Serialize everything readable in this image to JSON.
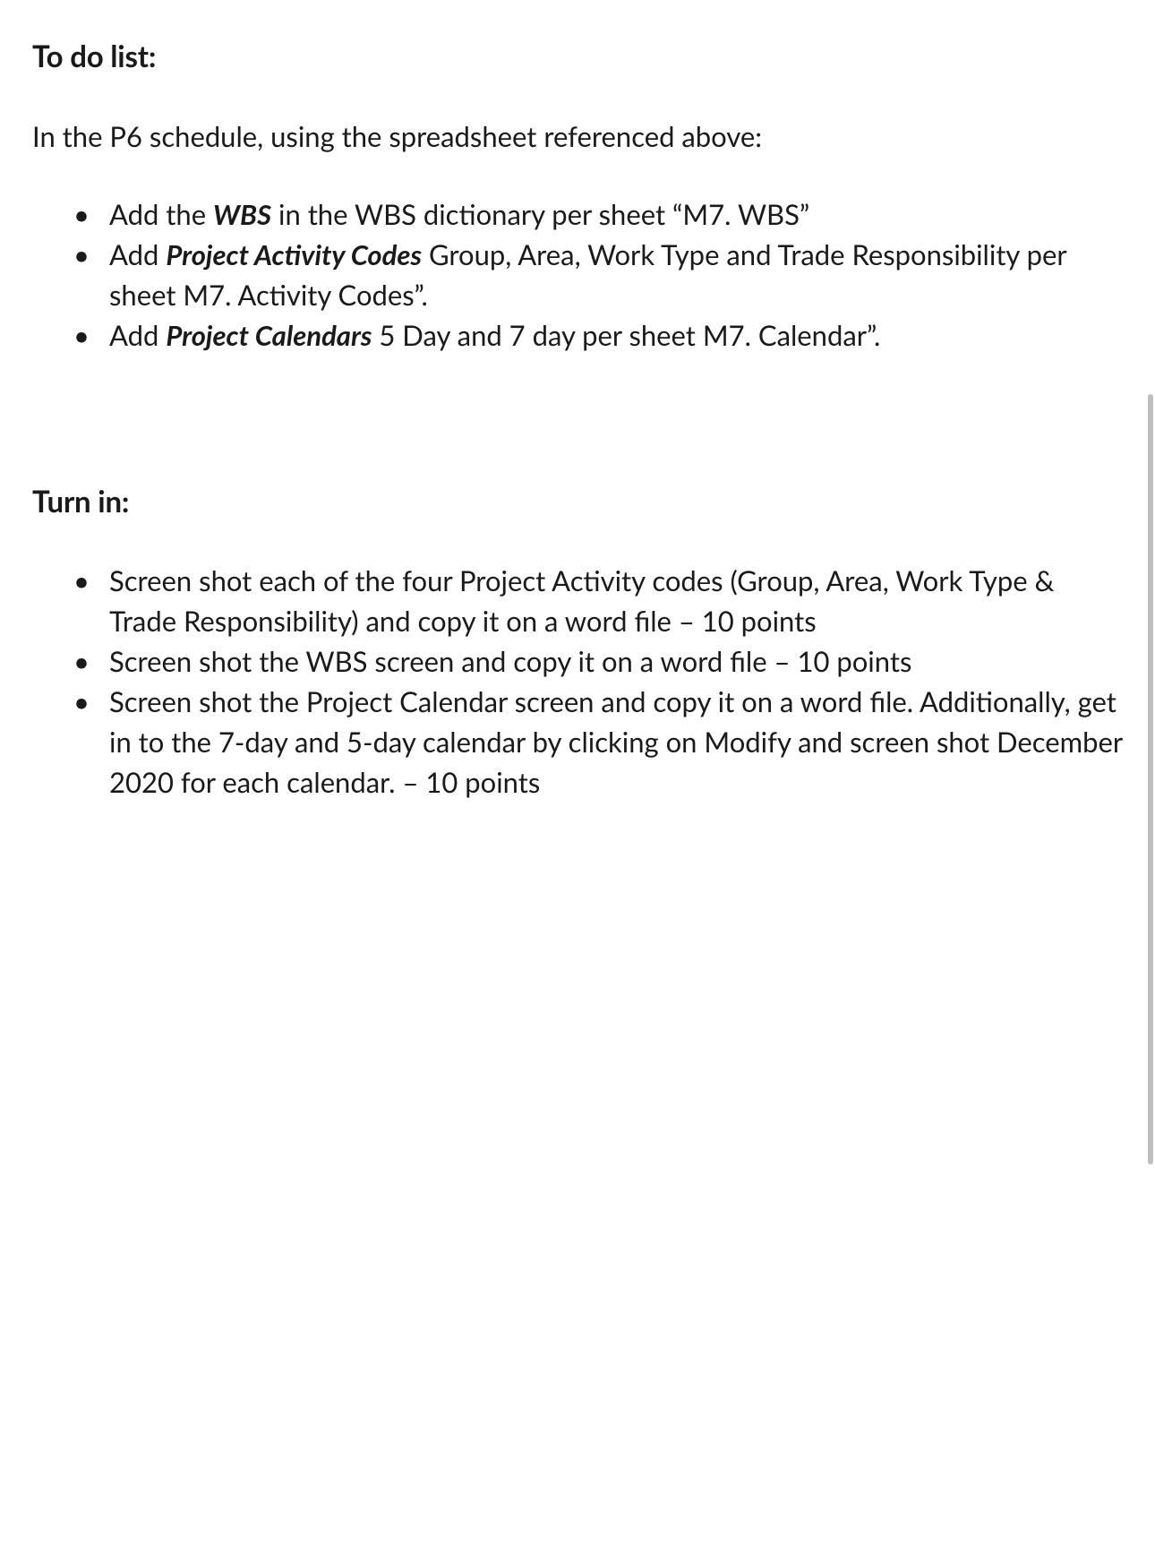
{
  "headings": {
    "todo": "To do list:",
    "turnin": "Turn in:"
  },
  "intro": "In the P6 schedule, using the spreadsheet referenced above:",
  "todo_items": [
    {
      "prefix": "Add the ",
      "emph": "WBS",
      "suffix": " in the WBS dictionary per sheet “M7. WBS”"
    },
    {
      "prefix": "Add ",
      "emph": "Project Activity Codes",
      "suffix": " Group, Area, Work Type and Trade Responsibility per sheet M7. Activity Codes”."
    },
    {
      "prefix": "Add ",
      "emph": "Project Calendars",
      "suffix": " 5 Day and 7 day per sheet M7. Calendar”."
    }
  ],
  "turnin_items": [
    "Screen shot each of the four Project Activity codes (Group, Area, Work Type & Trade Responsibility) and copy it on a word file – 10 points",
    "Screen shot the WBS screen and copy it on a word file – 10 points",
    "Screen shot the Project Calendar screen and copy it on a word file. Additionally, get in to the 7-day and 5-day calendar by clicking on Modify and screen shot December 2020 for each calendar. – 10 points"
  ]
}
